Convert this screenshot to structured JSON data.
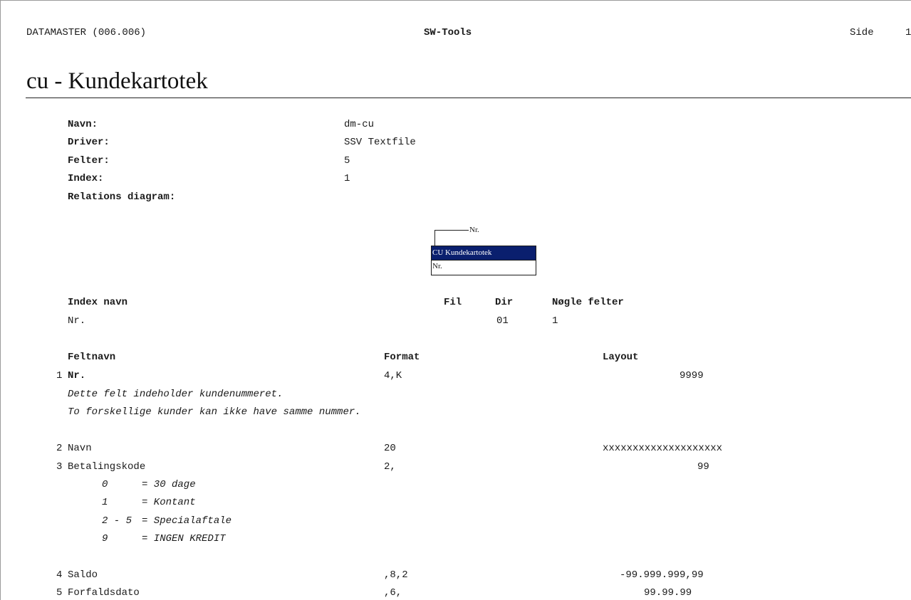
{
  "header": {
    "left": "DATAMASTER (006.006)",
    "center": "SW-Tools",
    "page_label": "Side",
    "page_number": "1"
  },
  "title": "cu - Kundekartotek",
  "info": [
    {
      "label": "Navn:",
      "value": "dm-cu"
    },
    {
      "label": "Driver:",
      "value": "SSV Textfile"
    },
    {
      "label": "Felter:",
      "value": "5"
    },
    {
      "label": "Index:",
      "value": "1"
    },
    {
      "label": "Relations diagram:",
      "value": ""
    }
  ],
  "diagram": {
    "key_label": "Nr.",
    "table_name": "CU Kundekartotek",
    "field": "Nr."
  },
  "index_table": {
    "headers": [
      "Index navn",
      "Fil",
      "Dir",
      "Nøgle felter"
    ],
    "rows": [
      {
        "name": "Nr.",
        "fil": "",
        "dir": "01",
        "keys": "1"
      }
    ]
  },
  "field_table": {
    "headers": [
      "Feltnavn",
      "Format",
      "Layout"
    ],
    "rows": [
      {
        "num": "1",
        "name": "Nr.",
        "format": "4,K",
        "layout": "9999",
        "bold_name": true,
        "notes": [
          "Dette felt indeholder kundenummeret.",
          "To forskellige kunder kan ikke have samme nummer."
        ]
      },
      {
        "num": "2",
        "name": "Navn",
        "format": "20",
        "layout": "xxxxxxxxxxxxxxxxxxxx"
      },
      {
        "num": "3",
        "name": "Betalingskode",
        "format": "2,",
        "layout": "99",
        "codes": [
          {
            "code": "0",
            "desc": "= 30 dage"
          },
          {
            "code": "1",
            "desc": "= Kontant"
          },
          {
            "code": "2 - 5",
            "desc": "= Specialaftale"
          },
          {
            "code": "9",
            "desc": "= INGEN KREDIT"
          }
        ]
      },
      {
        "num": "4",
        "name": "Saldo",
        "format": ",8,2",
        "layout": "-99.999.999,99"
      },
      {
        "num": "5",
        "name": "Forfaldsdato",
        "format": ",6,",
        "layout": "99.99.99"
      }
    ]
  }
}
